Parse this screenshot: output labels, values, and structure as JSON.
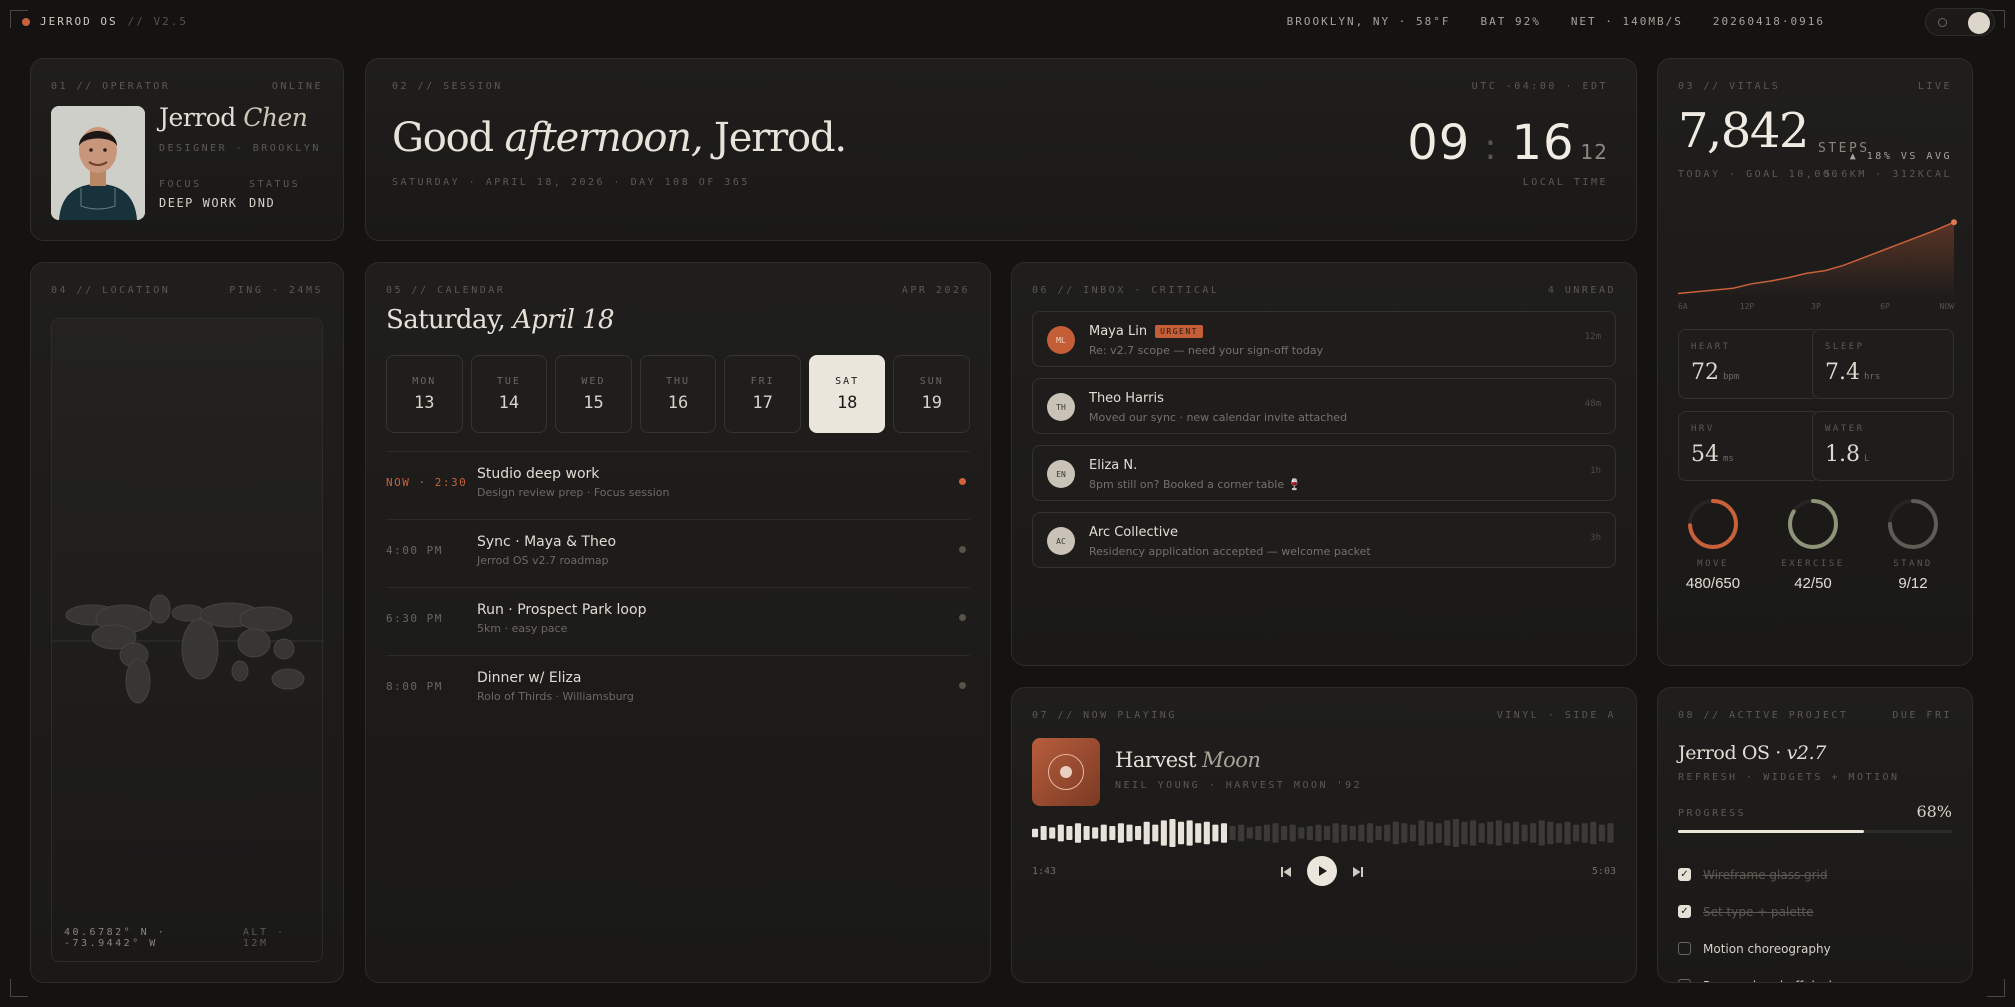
{
  "topbar": {
    "name": "JERROD OS",
    "version": "// V2.5",
    "location": "BROOKLYN, NY · 58°F",
    "battery": "BAT 92%",
    "network": "NET · 140MB/S",
    "datecode": "20260418·0916"
  },
  "operator": {
    "label": "01 // OPERATOR",
    "status": "ONLINE",
    "first_name": "Jerrod",
    "last_name": "Chen",
    "role": "DESIGNER · BROOKLYN",
    "focus_label": "FOCUS",
    "focus_value": "DEEP WORK",
    "status_label": "STATUS",
    "status_value": "DND"
  },
  "session": {
    "label": "02 // SESSION",
    "tz": "UTC -04:00 · EDT",
    "greeting_a": "Good",
    "greeting_b": "afternoon,",
    "greeting_c": "Jerrod.",
    "date_line": "SATURDAY · APRIL 18, 2026 · DAY 108 OF 365",
    "hour": "09",
    "minute": "16",
    "second": "12",
    "clock_label": "LOCAL TIME"
  },
  "vitals": {
    "label": "03 // VITALS",
    "status": "LIVE",
    "steps": "7,842",
    "steps_unit": "STEPS",
    "steps_sub": "TODAY · GOAL 10,000",
    "vs_avg": "▲ 18% VS AVG",
    "dist": "5.6KM · 312KCAL",
    "chart_ticks": [
      "6A",
      "12P",
      "3P",
      "6P",
      "NOW"
    ],
    "chart_values": [
      0.04,
      0.06,
      0.08,
      0.1,
      0.15,
      0.18,
      0.22,
      0.27,
      0.3,
      0.36,
      0.44,
      0.52,
      0.6,
      0.68,
      0.76,
      0.85
    ],
    "tiles": [
      {
        "label": "HEART",
        "value": "72",
        "unit": "bpm"
      },
      {
        "label": "SLEEP",
        "value": "7.4",
        "unit": "hrs"
      },
      {
        "label": "HRV",
        "value": "54",
        "unit": "ms"
      },
      {
        "label": "WATER",
        "value": "1.8",
        "unit": "L"
      }
    ],
    "rings": [
      {
        "label": "MOVE",
        "value": "480/650",
        "fraction": 0.74,
        "color": "#c8603a"
      },
      {
        "label": "EXERCISE",
        "value": "42/50",
        "fraction": 0.84,
        "color": "#8e9478"
      },
      {
        "label": "STAND",
        "value": "9/12",
        "fraction": 0.75,
        "color": "#5f5b55"
      }
    ]
  },
  "location": {
    "label": "04 // LOCATION",
    "ping": "PING · 24MS",
    "coords": "40.6782° N · -73.9442° W",
    "alt": "ALT · 12M"
  },
  "calendar": {
    "label": "05 // CALENDAR",
    "month": "APR 2026",
    "title_a": "Saturday,",
    "title_b": "April 18",
    "days": [
      {
        "name": "MON",
        "num": "13"
      },
      {
        "name": "TUE",
        "num": "14"
      },
      {
        "name": "WED",
        "num": "15"
      },
      {
        "name": "THU",
        "num": "16"
      },
      {
        "name": "FRI",
        "num": "17"
      },
      {
        "name": "SAT",
        "num": "18"
      },
      {
        "name": "SUN",
        "num": "19"
      }
    ],
    "events": [
      {
        "time": "NOW · 2:30",
        "name": "Studio deep work",
        "sub": "Design review prep · Focus session"
      },
      {
        "time": "4:00 PM",
        "name": "Sync · Maya & Theo",
        "sub": "Jerrod OS v2.7 roadmap"
      },
      {
        "time": "6:30 PM",
        "name": "Run · Prospect Park loop",
        "sub": "5km · easy pace"
      },
      {
        "time": "8:00 PM",
        "name": "Dinner w/ Eliza",
        "sub": "Rolo of Thirds · Williamsburg"
      }
    ]
  },
  "inbox": {
    "label": "06 // INBOX · CRITICAL",
    "unread": "4 UNREAD",
    "mails": [
      {
        "initials": "ML",
        "name": "Maya Lin",
        "badge": "URGENT",
        "subject": "Re: v2.7 scope — need your sign-off today",
        "time": "12m"
      },
      {
        "initials": "TH",
        "name": "Theo Harris",
        "badge": "",
        "subject": "Moved our sync · new calendar invite attached",
        "time": "48m"
      },
      {
        "initials": "EN",
        "name": "Eliza N.",
        "badge": "",
        "subject": "8pm still on? Booked a corner table 🍷",
        "time": "1h"
      },
      {
        "initials": "AC",
        "name": "Arc Collective",
        "badge": "",
        "subject": "Residency application accepted — welcome packet",
        "time": "3h"
      }
    ]
  },
  "player": {
    "label": "07 // NOW PLAYING",
    "source": "VINYL · SIDE A",
    "track_a": "Harvest",
    "track_b": "Moon",
    "artist": "NEIL YOUNG · HARVEST MOON '92",
    "elapsed": "1:43",
    "total": "5:03",
    "progress": 0.34,
    "wave": [
      0.3,
      0.5,
      0.4,
      0.6,
      0.5,
      0.7,
      0.5,
      0.4,
      0.6,
      0.5,
      0.7,
      0.6,
      0.5,
      0.8,
      0.6,
      0.9,
      1.0,
      0.8,
      0.9,
      0.7,
      0.8,
      0.6,
      0.7,
      0.5,
      0.6,
      0.4,
      0.5,
      0.6,
      0.7,
      0.5,
      0.6,
      0.4,
      0.5,
      0.6,
      0.5,
      0.7,
      0.6,
      0.5,
      0.6,
      0.7,
      0.5,
      0.6,
      0.8,
      0.7,
      0.6,
      0.9,
      0.8,
      0.7,
      0.9,
      1.0,
      0.8,
      0.9,
      0.7,
      0.8,
      0.9,
      0.7,
      0.8,
      0.6,
      0.7,
      0.9,
      0.8,
      0.7,
      0.8,
      0.6,
      0.7,
      0.8,
      0.6,
      0.7
    ]
  },
  "project": {
    "label": "08 // ACTIVE PROJECT",
    "due": "DUE FRI",
    "title_a": "Jerrod OS ·",
    "title_b": "v2.7",
    "sub": "REFRESH · WIDGETS + MOTION",
    "progress_label": "PROGRESS",
    "progress": "68%",
    "progress_fraction": 0.68,
    "tasks": [
      {
        "text": "Wireframe glass grid",
        "done": true
      },
      {
        "text": "Set type + palette",
        "done": true
      },
      {
        "text": "Motion choreography",
        "done": false
      },
      {
        "text": "Prepare hand-off deck",
        "done": false
      }
    ]
  }
}
